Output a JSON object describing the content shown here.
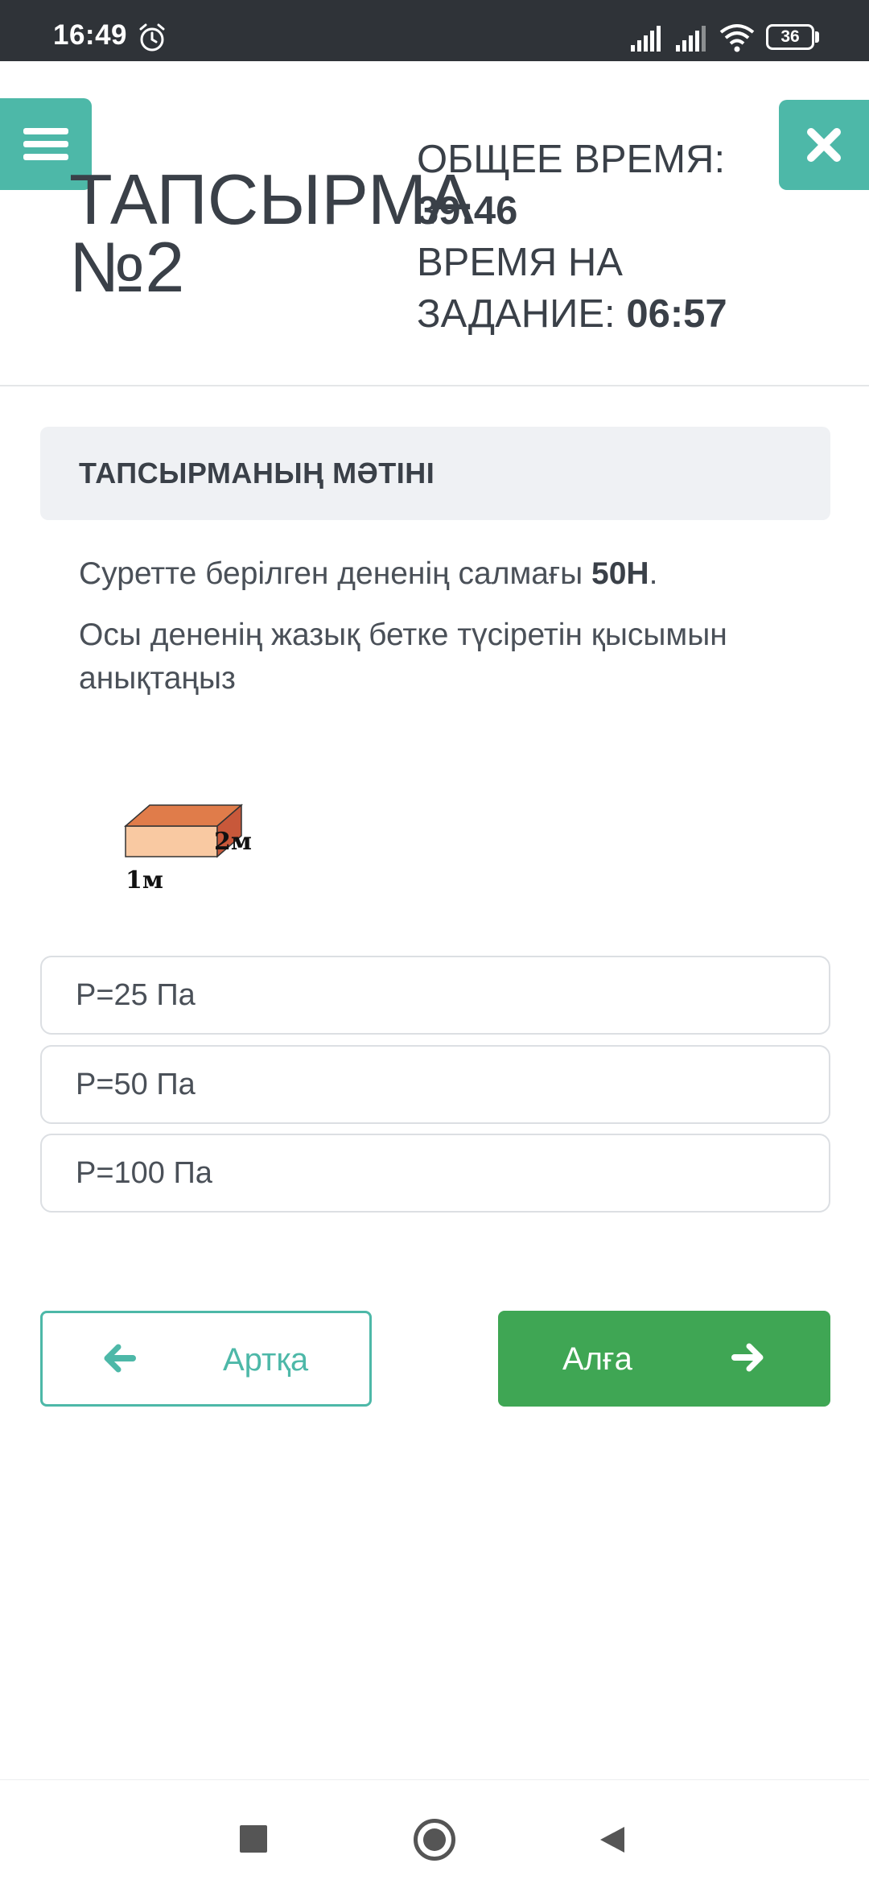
{
  "status_bar": {
    "time": "16:49",
    "battery_level": "36",
    "icons": [
      "alarm-icon",
      "signal-icon",
      "signal-icon",
      "wifi-icon",
      "battery-icon"
    ]
  },
  "header": {
    "title_line1": "ТАПСЫРМА",
    "title_line2": "№2",
    "total_time_label": "ОБЩЕЕ ВРЕМЯ:",
    "total_time_value": "39:46",
    "task_time_label_line1": "ВРЕМЯ НА",
    "task_time_label_line2": "ЗАДАНИЕ:",
    "task_time_value": "06:57",
    "menu_icon": "hamburger-icon",
    "close_icon": "close-icon"
  },
  "task": {
    "section_title": "ТАПСЫРМАНЫҢ МӘТІНІ",
    "line1_prefix": "Суретте берілген дененің салмағы ",
    "line1_bold": "50Н",
    "line1_suffix": ".",
    "line2": "Осы дененің жазық бетке түсіретін қысымын анықтаңыз",
    "figure": {
      "label_width": "1м",
      "label_length": "2м"
    }
  },
  "options": [
    {
      "label": "P=25 Па"
    },
    {
      "label": "P=50 Па"
    },
    {
      "label": "P=100 Па"
    }
  ],
  "navigation": {
    "back_label": "Артқа",
    "next_label": "Алға"
  },
  "colors": {
    "accent_teal": "#4db8a8",
    "next_green": "#3fa654",
    "status_bar": "#2f3338"
  }
}
